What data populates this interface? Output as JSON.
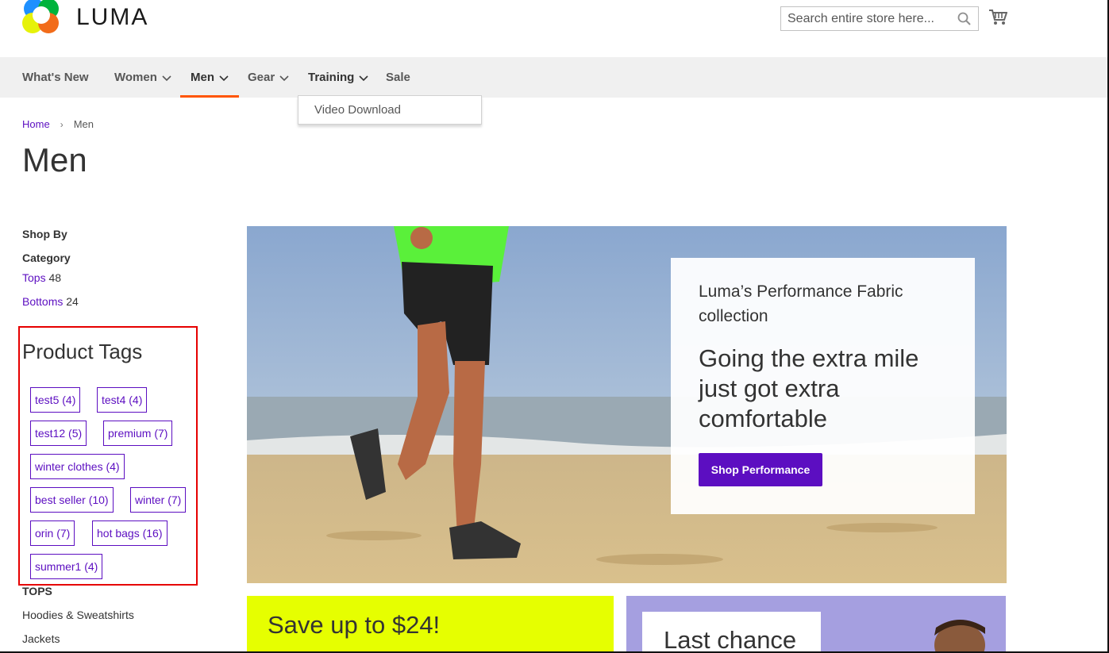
{
  "header": {
    "logo_text": "LUMA",
    "search_placeholder": "Search entire store here...",
    "cart_icon": "shopping-cart-icon"
  },
  "nav": {
    "items": [
      {
        "label": "What's New",
        "has_dropdown": false
      },
      {
        "label": "Women",
        "has_dropdown": true
      },
      {
        "label": "Men",
        "has_dropdown": true,
        "active": true
      },
      {
        "label": "Gear",
        "has_dropdown": true
      },
      {
        "label": "Training",
        "has_dropdown": true
      },
      {
        "label": "Sale",
        "has_dropdown": false
      }
    ],
    "submenu": {
      "item": "Video Download"
    },
    "active_color": "#ff5501"
  },
  "breadcrumb": {
    "home": "Home",
    "current": "Men"
  },
  "page_title": "Men",
  "sidebar": {
    "shop_by": "Shop By",
    "category_title": "Category",
    "categories": [
      {
        "label": "Tops",
        "count": "48"
      },
      {
        "label": "Bottoms",
        "count": "24"
      }
    ],
    "product_tags_title": "Product Tags",
    "tags": [
      "test5 (4)",
      "test4 (4)",
      "test12 (5)",
      "premium (7)",
      "winter clothes (4)",
      "best seller (10)",
      "winter (7)",
      "orin (7)",
      "hot bags (16)",
      "summer1 (4)"
    ],
    "tops_heading": "TOPS",
    "tops_links": [
      "Hoodies & Sweatshirts",
      "Jackets"
    ]
  },
  "hero": {
    "subtitle": "Luma’s Performance Fabric collection",
    "headline": "Going the extra mile just got extra comfortable",
    "button": "Shop Performance",
    "button_color": "#5c0ec1"
  },
  "promos": {
    "yellow_text": "Save up to $24!",
    "purple_text": "Last chance"
  },
  "colors": {
    "link": "#5c0ec1",
    "highlight_box": "#e60000",
    "promo_yellow": "#e6ff00",
    "promo_purple": "#a59fe0"
  }
}
